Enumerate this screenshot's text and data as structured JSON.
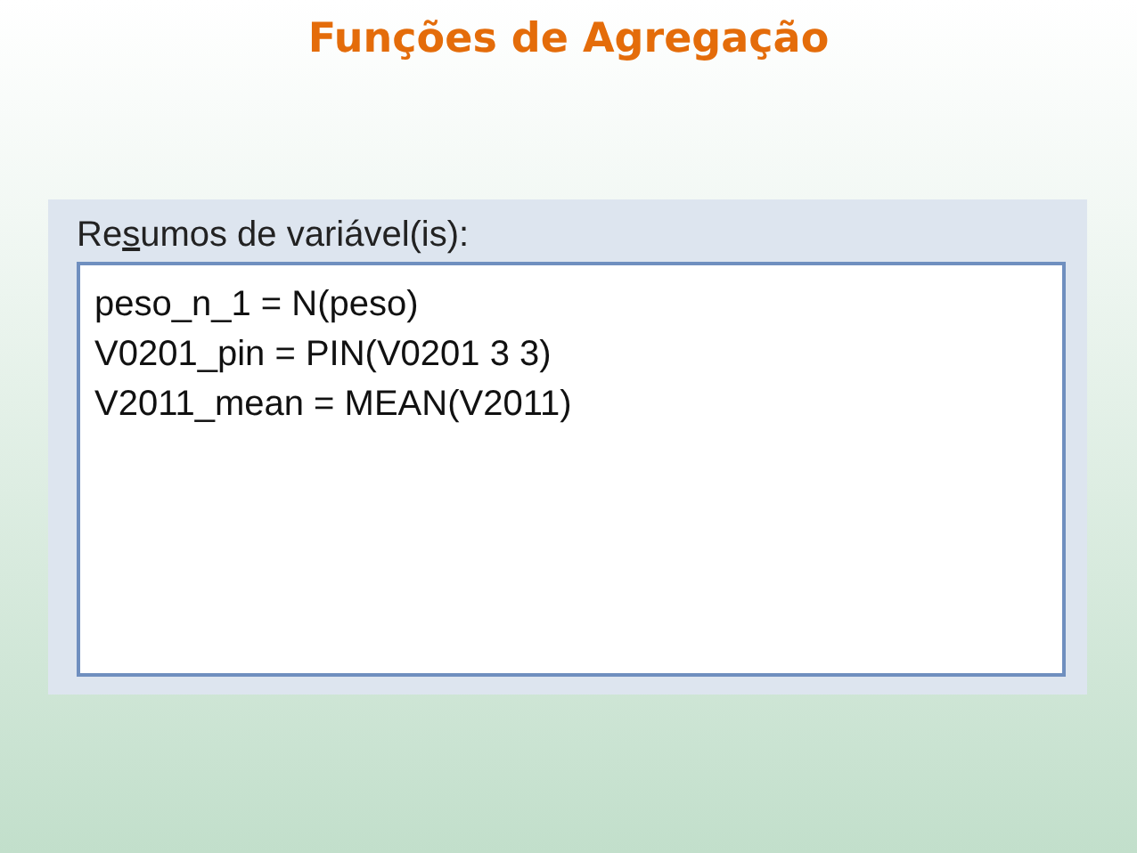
{
  "title": "Funções de Agregação",
  "dialog": {
    "label_before": "Re",
    "label_access_key": "s",
    "label_after": "umos de variável(is):",
    "summaries": [
      "peso_n_1 = N(peso)",
      "V0201_pin = PIN(V0201 3 3)",
      "V2011_mean = MEAN(V2011)"
    ]
  }
}
